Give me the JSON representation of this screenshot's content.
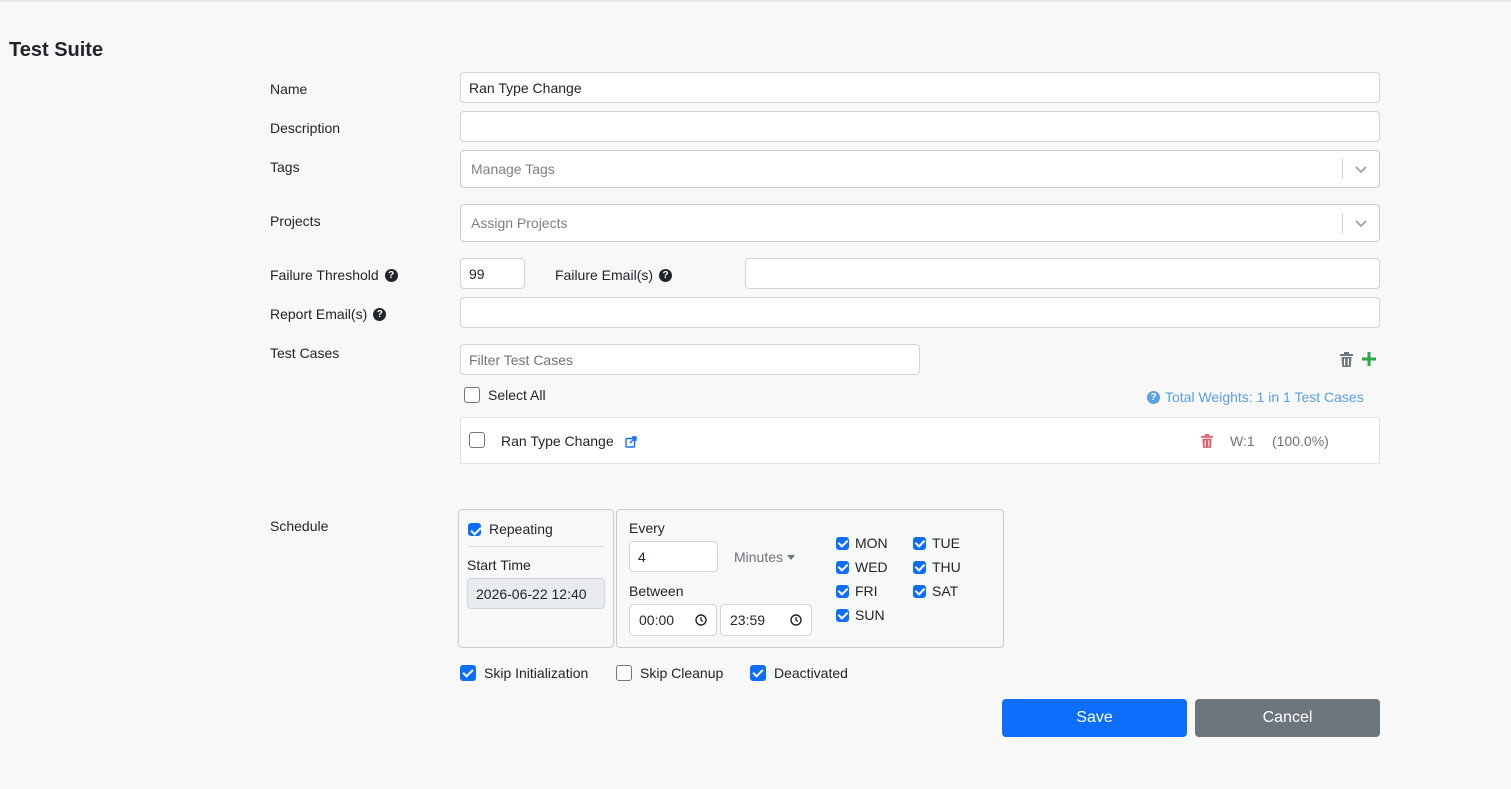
{
  "title": "Test Suite",
  "labels": {
    "name": "Name",
    "description": "Description",
    "tags": "Tags",
    "projects": "Projects",
    "failure_threshold": "Failure Threshold",
    "failure_emails": "Failure Email(s)",
    "report_emails": "Report Email(s)",
    "test_cases": "Test Cases",
    "schedule": "Schedule"
  },
  "fields": {
    "name_value": "Ran Type Change",
    "description_value": "",
    "tags_placeholder": "Manage Tags",
    "projects_placeholder": "Assign Projects",
    "failure_threshold_value": "99",
    "failure_emails_value": "",
    "report_emails_value": "",
    "filter_placeholder": "Filter Test Cases"
  },
  "test_cases": {
    "select_all_label": "Select All",
    "total_weights": "Total Weights: 1 in 1 Test Cases",
    "items": [
      {
        "name": "Ran Type Change",
        "weight": "W:1",
        "percent": "(100.0%)",
        "checked": false
      }
    ]
  },
  "schedule": {
    "repeating_label": "Repeating",
    "repeating_checked": true,
    "start_time_label": "Start Time",
    "start_time_value": "2026-06-22 12:40",
    "every_label": "Every",
    "every_value": "4",
    "unit": "Minutes",
    "between_label": "Between",
    "from": "00:00",
    "to": "23:59",
    "days": [
      {
        "label": "MON",
        "checked": true
      },
      {
        "label": "TUE",
        "checked": true
      },
      {
        "label": "WED",
        "checked": true
      },
      {
        "label": "THU",
        "checked": true
      },
      {
        "label": "FRI",
        "checked": true
      },
      {
        "label": "SAT",
        "checked": true
      },
      {
        "label": "SUN",
        "checked": true
      }
    ]
  },
  "options": {
    "skip_initialization": {
      "label": "Skip Initialization",
      "checked": true
    },
    "skip_cleanup": {
      "label": "Skip Cleanup",
      "checked": false
    },
    "deactivated": {
      "label": "Deactivated",
      "checked": true
    }
  },
  "actions": {
    "save": "Save",
    "cancel": "Cancel"
  },
  "colors": {
    "primary": "#0d6efd",
    "secondary": "#6c757d",
    "danger": "#e35d6a",
    "success": "#28a745",
    "info": "#5aa0e6"
  }
}
